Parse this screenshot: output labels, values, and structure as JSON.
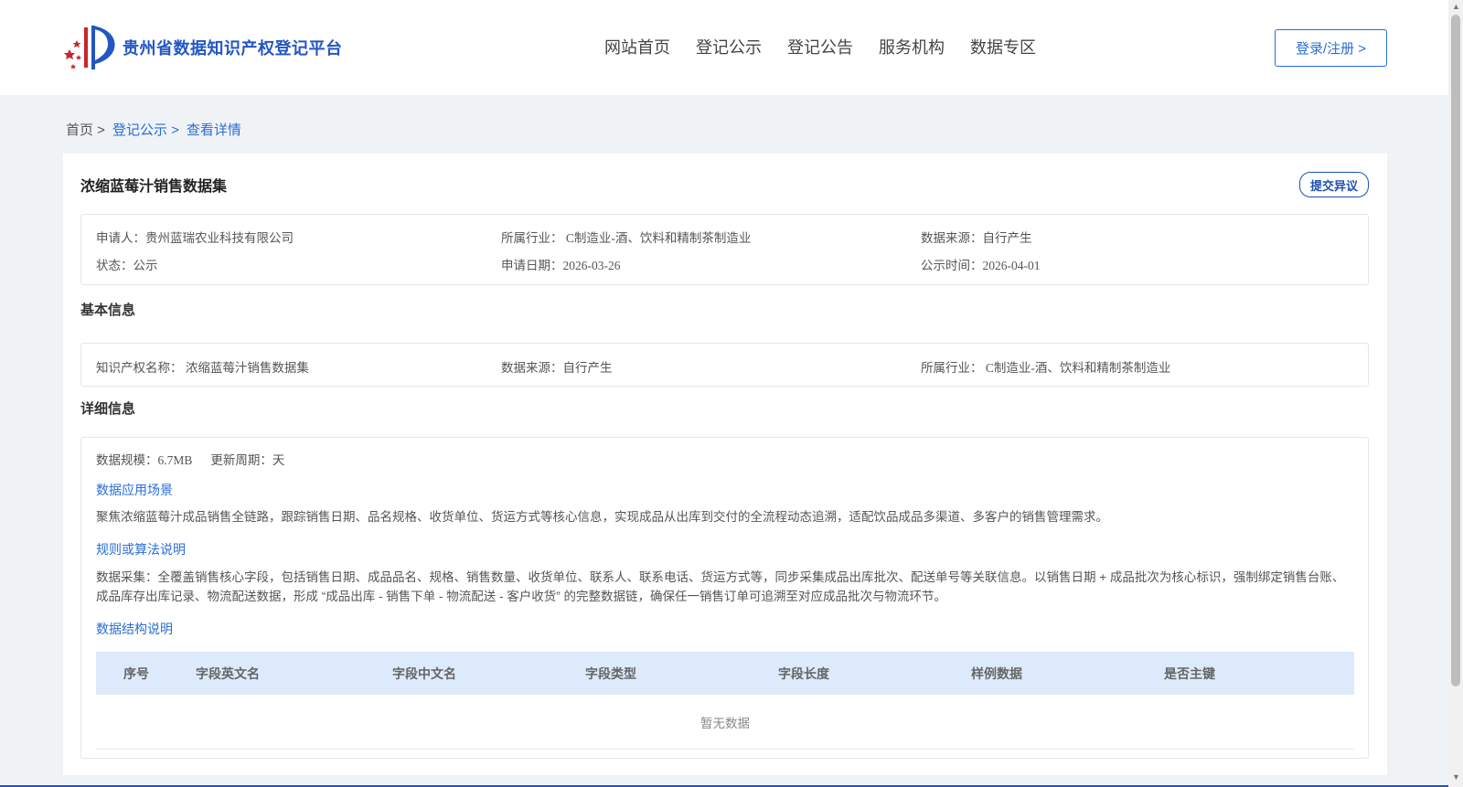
{
  "header": {
    "logo_text": "贵州省数据知识产权登记平台",
    "nav": [
      "网站首页",
      "登记公示",
      "登记公告",
      "服务机构",
      "数据专区"
    ],
    "login_label": "登录/注册 >"
  },
  "breadcrumb": {
    "home": "首页 >",
    "items": [
      "登记公示 >",
      "查看详情"
    ]
  },
  "detail": {
    "title": "浓缩蓝莓汁销售数据集",
    "objection_label": "提交异议",
    "summary": {
      "applicant": "申请人：贵州蓝瑞农业科技有限公司",
      "industry": "所属行业： C制造业-酒、饮料和精制茶制造业",
      "source": "数据来源：自行产生",
      "status": "状态：公示",
      "apply_date": "申请日期：2026-03-26",
      "publish_date": "公示时间：2026-04-01"
    },
    "basic": {
      "title": "基本信息",
      "ip_name": "知识产权名称： 浓缩蓝莓汁销售数据集",
      "source": "数据来源：自行产生",
      "industry": "所属行业： C制造业-酒、饮料和精制茶制造业"
    },
    "info": {
      "title": "详细信息",
      "scale": "数据规模：6.7MB",
      "cycle": "更新周期：天",
      "scenario_title": "数据应用场景",
      "scenario_text": "聚焦浓缩蓝莓汁成品销售全链路，跟踪销售日期、品名规格、收货单位、货运方式等核心信息，实现成品从出库到交付的全流程动态追溯，适配饮品成品多渠道、多客户的销售管理需求。",
      "rules_title": "规则或算法说明",
      "rules_text": "数据采集：全覆盖销售核心字段，包括销售日期、成品品名、规格、销售数量、收货单位、联系人、联系电话、货运方式等，同步采集成品出库批次、配送单号等关联信息。以销售日期 + 成品批次为核心标识，强制绑定销售台账、成品库存出库记录、物流配送数据，形成 “成品出库 - 销售下单 - 物流配送 - 客户收货” 的完整数据链，确保任一销售订单可追溯至对应成品批次与物流环节。",
      "structure_title": "数据结构说明",
      "table_headers": [
        "序号",
        "字段英文名",
        "字段中文名",
        "字段类型",
        "字段长度",
        "样例数据",
        "是否主键"
      ],
      "empty_text": "暂无数据"
    }
  },
  "colors": {
    "accent": "#2a6dd6",
    "brand": "#2356c4",
    "table_header_bg": "#ddeafb",
    "page_bg": "#f0f3f6"
  }
}
